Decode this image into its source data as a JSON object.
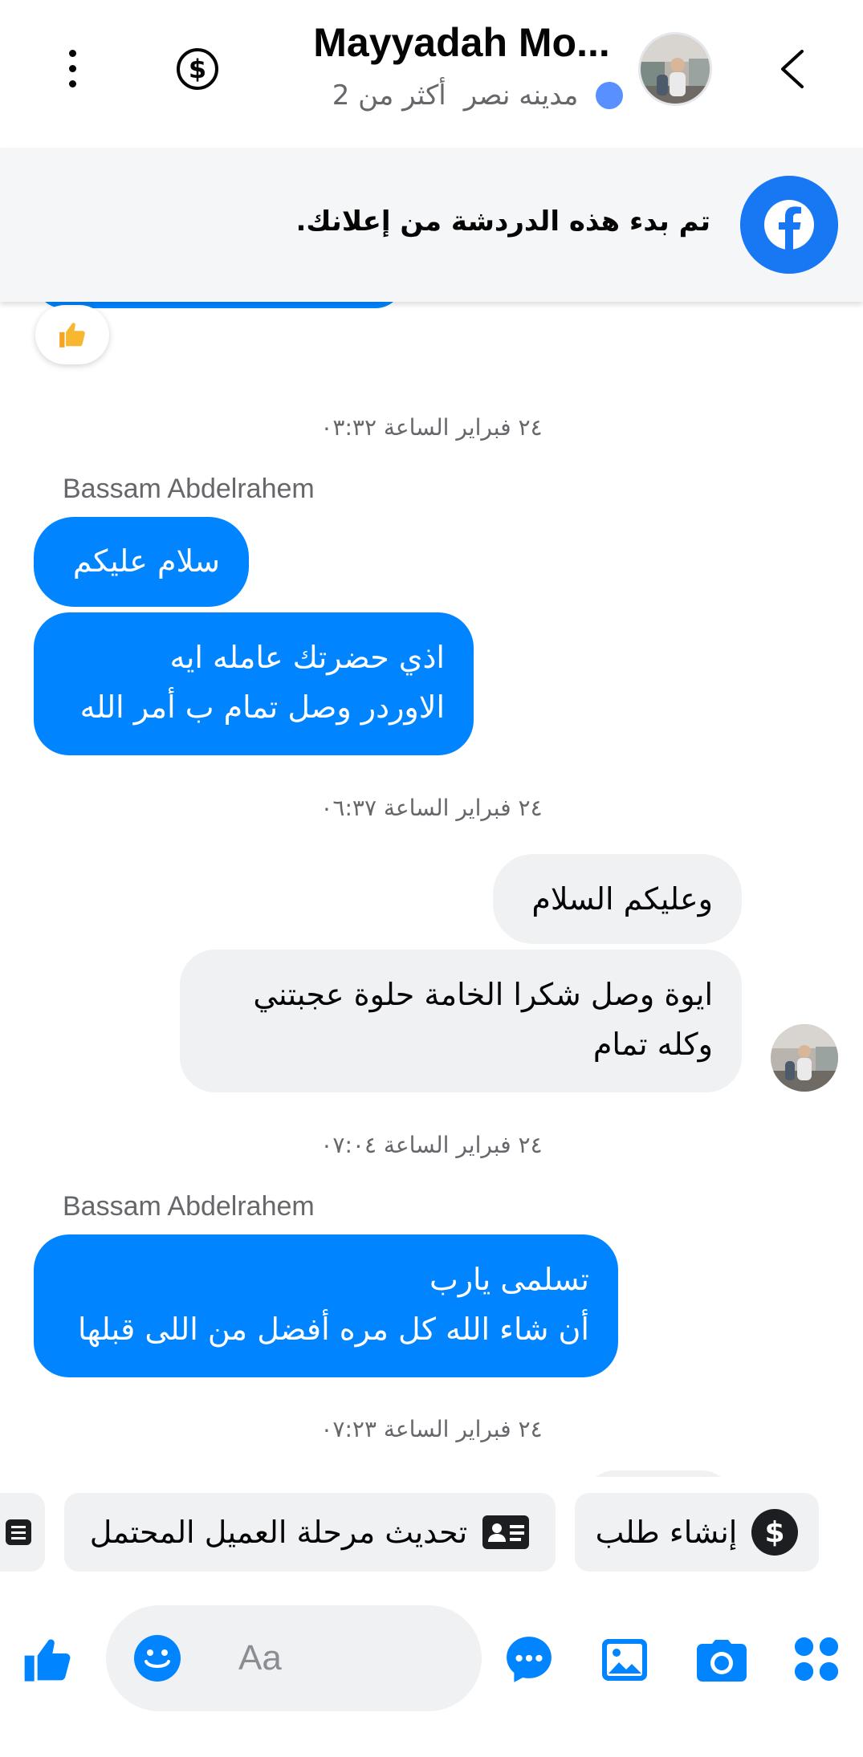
{
  "header": {
    "name": "Mayyadah Mo...",
    "location": "مدينه نصر",
    "subtitle_extra": "أكثر من 2"
  },
  "ad_banner": {
    "text": "تم بدء هذه الدردشة من إعلانك."
  },
  "messages": {
    "ts1": "٢٤ فبراير الساعة ٠٣:٣٢",
    "sender1": "Bassam Abdelrahem",
    "m1": "سلام عليكم",
    "m2_line1": "اذي حضرتك عامله ايه",
    "m2_line2": "الاوردر وصل تمام ب أمر الله",
    "ts2": "٢٤ فبراير الساعة ٠٦:٣٧",
    "m3": "وعليكم السلام",
    "m4_line1": "ايوة وصل شكرا الخامة حلوة عجبتني",
    "m4_line2": "وكله تمام",
    "ts3": "٢٤ فبراير الساعة ٠٧:٠٤",
    "sender2": "Bassam Abdelrahem",
    "m5_line1": "تسلمى يارب",
    "m5_line2": "أن شاء الله كل مره أفضل من اللى قبلها",
    "ts4": "٢٤ فبراير الساعة ٠٧:٢٣"
  },
  "quick_actions": {
    "create_order": "إنشاء طلب",
    "update_stage": "تحديث مرحلة العميل المحتمل"
  },
  "composer": {
    "placeholder": "Aa"
  },
  "colors": {
    "accent": "#0084ff",
    "brand": "#1877f2",
    "incoming_bubble": "#f0f1f3",
    "muted_text": "#65676b"
  },
  "icons": {
    "menu": "more-vertical-icon",
    "dollar": "dollar-icon",
    "back": "chevron-left-icon",
    "facebook": "facebook-logo-icon",
    "thumbs_up": "thumbs-up-icon",
    "emoji": "smiley-icon",
    "message": "chat-bubble-icon",
    "gallery": "image-icon",
    "camera": "camera-icon",
    "apps": "apps-grid-icon",
    "id_card": "contact-card-icon",
    "list": "list-icon"
  }
}
